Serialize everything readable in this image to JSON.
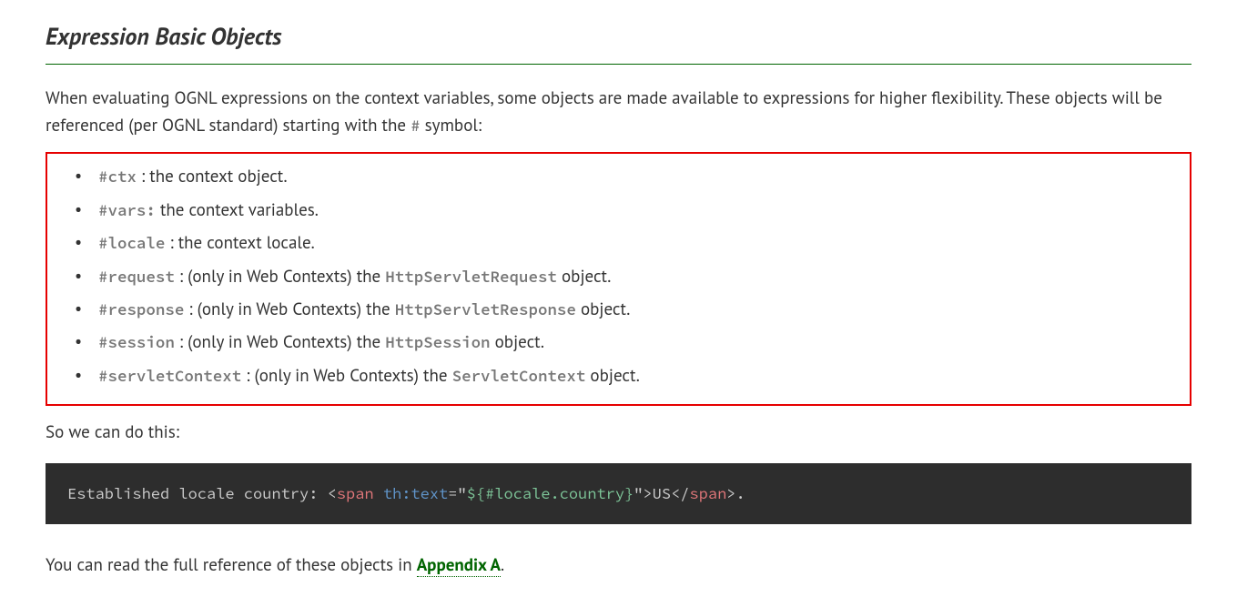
{
  "title": "Expression Basic Objects",
  "intro": {
    "part1": "When evaluating OGNL expressions on the context variables, some objects are made available to expressions for higher flexibility. These objects will be referenced (per OGNL standard) starting with the ",
    "hash": "#",
    "part2": " symbol:"
  },
  "objects": [
    {
      "key": "#ctx",
      "sep": " : ",
      "pre": "",
      "desc": "the context object."
    },
    {
      "key": "#vars:",
      "sep": " ",
      "pre": "",
      "desc": "the context variables."
    },
    {
      "key": "#locale",
      "sep": " : ",
      "pre": "",
      "desc": "the context locale."
    },
    {
      "key": "#request",
      "sep": " : ",
      "pre": "(only in Web Contexts) the ",
      "cls": "HttpServletRequest",
      "desc": " object."
    },
    {
      "key": "#response",
      "sep": " : ",
      "pre": "(only in Web Contexts) the ",
      "cls": "HttpServletResponse",
      "desc": " object."
    },
    {
      "key": "#session",
      "sep": " : ",
      "pre": "(only in Web Contexts) the ",
      "cls": "HttpSession",
      "desc": " object."
    },
    {
      "key": "#servletContext",
      "sep": " : ",
      "pre": "(only in Web Contexts) the ",
      "cls": "ServletContext",
      "desc": " object."
    }
  ],
  "so_we": "So we can do this:",
  "code": {
    "lead": "Established locale country: ",
    "open_angle": "<",
    "tag_span": "span",
    "space": " ",
    "attr_thtext": "th:text",
    "eq": "=",
    "q": "\"",
    "val": "${#locale.country}",
    "close_angle": ">",
    "inner": "US",
    "open_slash": "</",
    "dot": "."
  },
  "outro": {
    "part1": "You can read the full reference of these objects in ",
    "link": "Appendix A",
    "part2": "."
  }
}
